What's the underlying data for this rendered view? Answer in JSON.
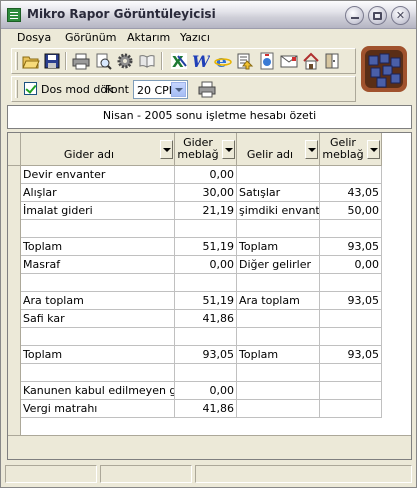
{
  "window": {
    "title": "Mikro Rapor Görüntüleyicisi"
  },
  "menu": {
    "items": [
      "Dosya",
      "Görünüm",
      "Aktarım",
      "Yazıcı"
    ]
  },
  "toolbar": {
    "dos_mode_label": "Dos mod dök",
    "dos_mode_checked": true,
    "font_label": "Font",
    "font_value": "20 CPI"
  },
  "report": {
    "title": "Nisan   - 2005 sonu işletme hesabı özeti"
  },
  "table": {
    "headers": {
      "gider_adi": "Gider adı",
      "gider_meblag_1": "Gider",
      "gider_meblag_2": "meblağ",
      "gelir_adi": "Gelir adı",
      "gelir_meblag_1": "Gelir",
      "gelir_meblag_2": "meblağ"
    },
    "rows": [
      [
        "Devir envanter",
        "0,00",
        "",
        ""
      ],
      [
        "Alışlar",
        "30,00",
        "Satışlar",
        "43,05"
      ],
      [
        "İmalat gideri",
        "21,19",
        "şimdiki envanter",
        "50,00"
      ],
      [
        "",
        "",
        "",
        ""
      ],
      [
        "Toplam",
        "51,19",
        "Toplam",
        "93,05"
      ],
      [
        "Masraf",
        "0,00",
        "Diğer gelirler",
        "0,00"
      ],
      [
        "",
        "",
        "",
        ""
      ],
      [
        "Ara toplam",
        "51,19",
        "Ara toplam",
        "93,05"
      ],
      [
        "Safi kar",
        "41,86",
        "",
        ""
      ],
      [
        "",
        "",
        "",
        ""
      ],
      [
        "Toplam",
        "93,05",
        "Toplam",
        "93,05"
      ],
      [
        "",
        "",
        "",
        ""
      ],
      [
        "Kanunen kabul edilmeyen gider",
        "0,00",
        "",
        ""
      ],
      [
        "Vergi matrahı",
        "41,86",
        "",
        ""
      ]
    ]
  },
  "toolbar_icons": [
    "open-icon",
    "save-icon",
    "print-icon",
    "print-preview-icon",
    "settings-icon",
    "book-icon",
    "excel-icon",
    "word-icon",
    "browser-icon",
    "export-icon",
    "html-icon",
    "mail-icon",
    "home-icon",
    "exit-icon"
  ]
}
